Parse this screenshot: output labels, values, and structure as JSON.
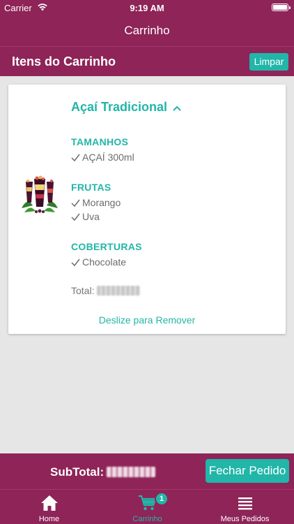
{
  "status_bar": {
    "carrier": "Carrier",
    "time": "9:19 AM"
  },
  "nav": {
    "title": "Carrinho"
  },
  "cart_header": {
    "title": "Itens do Carrinho",
    "clear_label": "Limpar"
  },
  "cart_item": {
    "product_name": "Açaí Tradicional",
    "groups": [
      {
        "title": "TAMANHOS",
        "options": [
          "AÇAÍ 300ml"
        ]
      },
      {
        "title": "FRUTAS",
        "options": [
          "Morango",
          "Uva"
        ]
      },
      {
        "title": "COBERTURAS",
        "options": [
          "Chocolate"
        ]
      }
    ],
    "total_label": "Total:",
    "swipe_hint": "Deslize para Remover"
  },
  "footer": {
    "subtotal_label": "SubTotal:",
    "close_order_label": "Fechar Pedido"
  },
  "tabs": [
    {
      "label": "Home",
      "icon": "home-icon",
      "active": false
    },
    {
      "label": "Carrinho",
      "icon": "cart-icon",
      "active": true,
      "badge": "1"
    },
    {
      "label": "Meus Pedidos",
      "icon": "list-icon",
      "active": false
    }
  ],
  "colors": {
    "brand": "#8e2458",
    "accent": "#21b6a8",
    "background": "#e6e6e6"
  }
}
